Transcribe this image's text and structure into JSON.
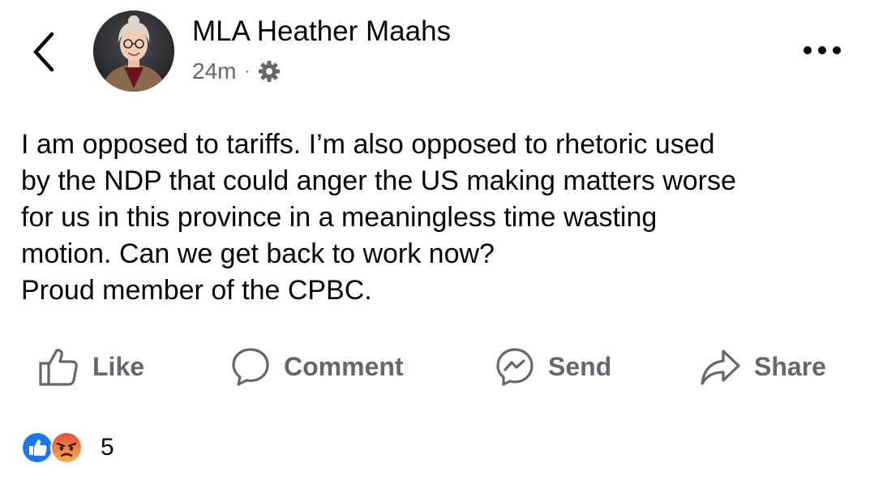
{
  "header": {
    "author": "MLA Heather Maahs",
    "time": "24m",
    "separator": "·"
  },
  "post": {
    "lines": [
      "I am opposed to tariffs. I’m also opposed to rhetoric used",
      "by the NDP that could anger the US making matters worse",
      "for us in this province in a meaningless time wasting",
      "motion. Can we get back to work now?",
      "Proud member of the CPBC."
    ]
  },
  "actions": {
    "like": "Like",
    "comment": "Comment",
    "send": "Send",
    "share": "Share"
  },
  "reactions": {
    "count": "5",
    "types": [
      "like",
      "angry"
    ]
  },
  "colors": {
    "text": "#050505",
    "secondary": "#65676b",
    "like_blue": "#1877f2",
    "angry_orange": "#f0703b"
  },
  "icons": {
    "back": "chevron-left-icon",
    "privacy": "gear-icon",
    "more": "more-horizontal-icon",
    "like": "thumbs-up-icon",
    "comment": "speech-bubble-icon",
    "send": "messenger-icon",
    "share": "share-arrow-icon"
  }
}
